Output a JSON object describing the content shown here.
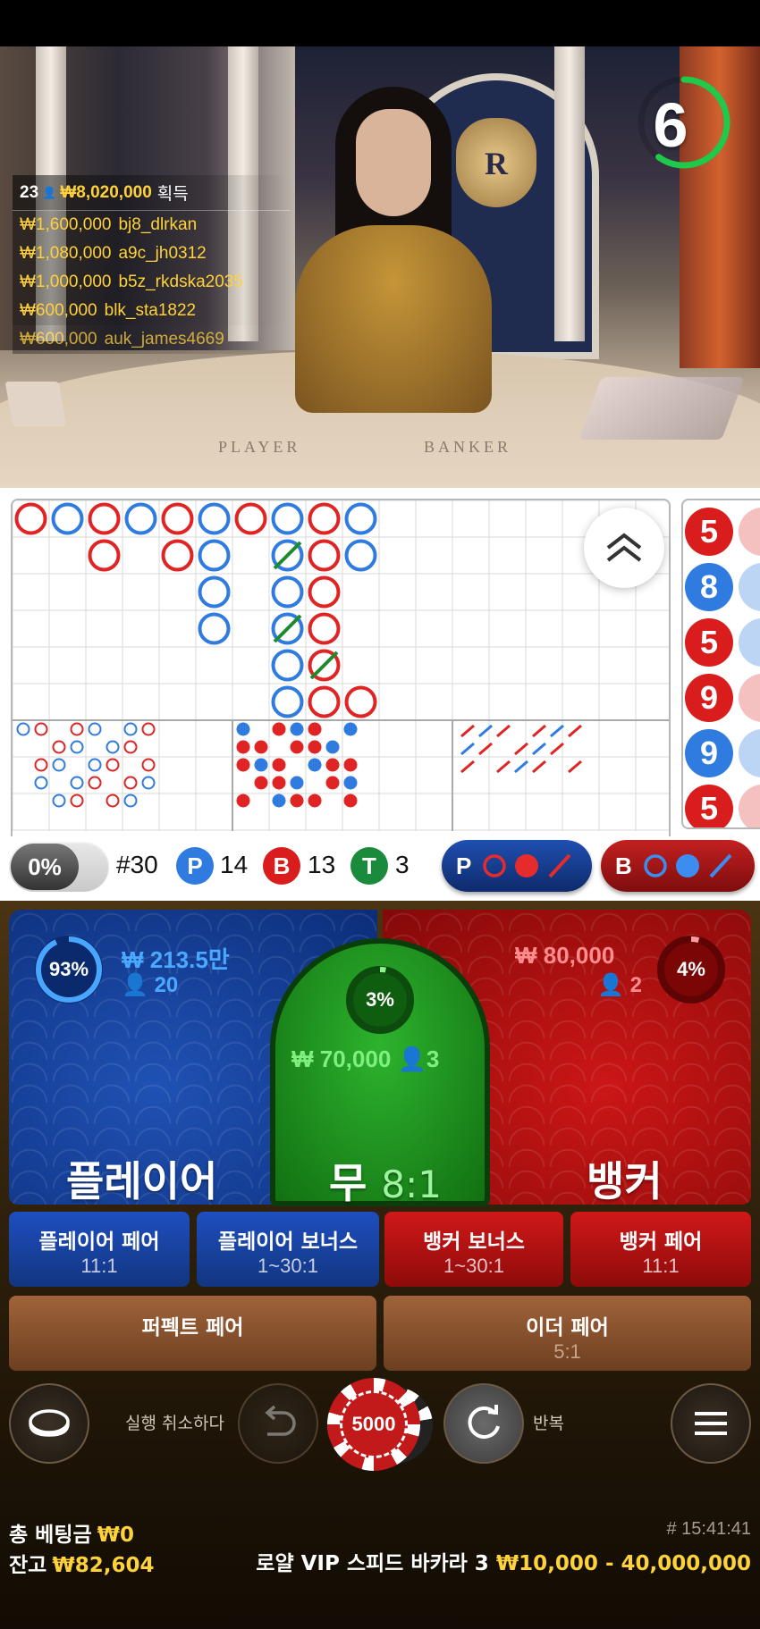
{
  "timer": {
    "value": "6",
    "fraction": 0.6
  },
  "winners": {
    "count": "23",
    "total": "₩8,020,000",
    "label": "획득",
    "rows": [
      {
        "amount": "₩1,600,000",
        "name": "bj8_dlrkan"
      },
      {
        "amount": "₩1,080,000",
        "name": "a9c_jh0312"
      },
      {
        "amount": "₩1,000,000",
        "name": "b5z_rkdska2035"
      },
      {
        "amount": "₩600,000",
        "name": "blk_sta1822"
      },
      {
        "amount": "₩600,000",
        "name": "auk_james4669"
      }
    ]
  },
  "table_text": {
    "player": "PLAYER",
    "banker": "BANKER",
    "crest": "R"
  },
  "side_road": [
    "5",
    "8",
    "5",
    "9",
    "9",
    "5"
  ],
  "stats": {
    "percent": "0%",
    "round": "#30",
    "player_letter": "P",
    "player_count": "14",
    "banker_letter": "B",
    "banker_count": "13",
    "tie_letter": "T",
    "tie_count": "3",
    "predict_player": "P",
    "predict_banker": "B"
  },
  "bets": {
    "player": {
      "percent": "93%",
      "amount": "₩ 213.5만",
      "players": "20",
      "label": "플레이어",
      "ratio": 0.93
    },
    "tie": {
      "percent": "3%",
      "amount": "₩ 70,000",
      "players": "3",
      "label": "무",
      "odds": "8:1",
      "ratio": 0.03
    },
    "banker": {
      "percent": "4%",
      "amount": "₩ 80,000",
      "players": "2",
      "label": "뱅커",
      "ratio": 0.04
    }
  },
  "side_bets": [
    {
      "label": "플레이어 페어",
      "odds": "11:1"
    },
    {
      "label": "플레이어 보너스",
      "odds": "1~30:1"
    },
    {
      "label": "뱅커 보너스",
      "odds": "1~30:1"
    },
    {
      "label": "뱅커 페어",
      "odds": "11:1"
    }
  ],
  "pair_bets": [
    {
      "label": "퍼펙트 페어",
      "odds": ""
    },
    {
      "label": "이더 페어",
      "odds": "5:1"
    }
  ],
  "controls": {
    "undo_label": "실행 취소하다",
    "chip_value": "5000",
    "repeat_label": "반복"
  },
  "footer": {
    "total_bet_label": "총 베팅금",
    "total_bet_value": "₩0",
    "balance_label": "잔고",
    "balance_value": "₩82,604",
    "time": "# 15:41:41",
    "table_name": "로얄 VIP 스피드 바카라 3",
    "limits": "₩10,000 - 40,000,000"
  },
  "colors": {
    "player": "#1f52b5",
    "banker": "#cc1616",
    "tie": "#2db32d",
    "gold": "#ffd23a"
  }
}
